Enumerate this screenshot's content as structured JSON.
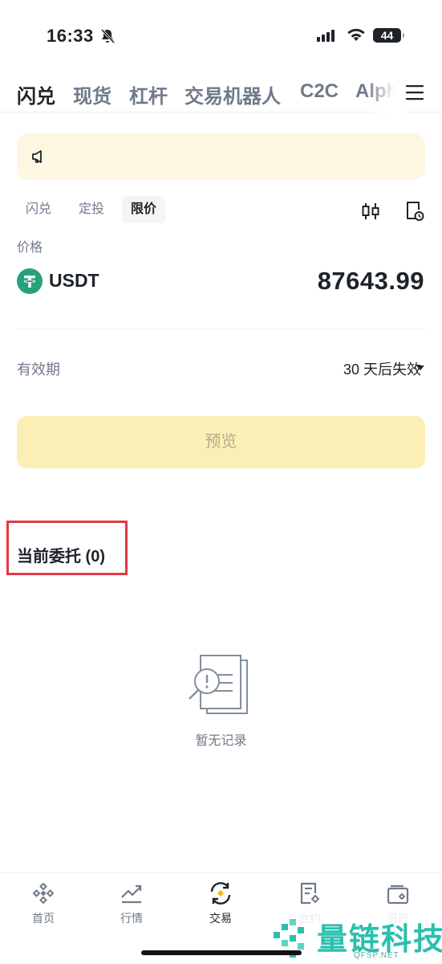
{
  "status_bar": {
    "time": "16:33",
    "battery": "44"
  },
  "top_tabs": [
    {
      "label": "闪兑",
      "active": true
    },
    {
      "label": "现货",
      "active": false
    },
    {
      "label": "杠杆",
      "active": false
    },
    {
      "label": "交易机器人",
      "active": false
    },
    {
      "label": "C2C",
      "active": false
    },
    {
      "label": "Alph",
      "active": false
    }
  ],
  "mode_tabs": [
    {
      "label": "闪兑",
      "active": false
    },
    {
      "label": "定投",
      "active": false
    },
    {
      "label": "限价",
      "active": true
    }
  ],
  "price": {
    "label": "价格",
    "currency": "USDT",
    "value": "87643.99"
  },
  "validity": {
    "label": "有效期",
    "value": "30 天后失效"
  },
  "preview_button": "预览",
  "orders": {
    "title": "当前委托 (0)",
    "empty_text": "暂无记录"
  },
  "bottom_nav": [
    {
      "label": "首页",
      "icon": "binance-home-icon",
      "active": false
    },
    {
      "label": "行情",
      "icon": "market-chart-icon",
      "active": false
    },
    {
      "label": "交易",
      "icon": "trade-swap-icon",
      "active": true
    },
    {
      "label": "合约",
      "icon": "futures-icon",
      "active": false
    },
    {
      "label": "资产",
      "icon": "wallet-icon",
      "active": false
    }
  ],
  "watermark": {
    "text": "量链科技",
    "sub": "QFSP.NET"
  },
  "colors": {
    "accent": "#f0b90b",
    "notice_bg": "#fdf6e1",
    "button_bg": "#fcefb5",
    "highlight": "#e03a44",
    "usdt": "#26a17b"
  }
}
